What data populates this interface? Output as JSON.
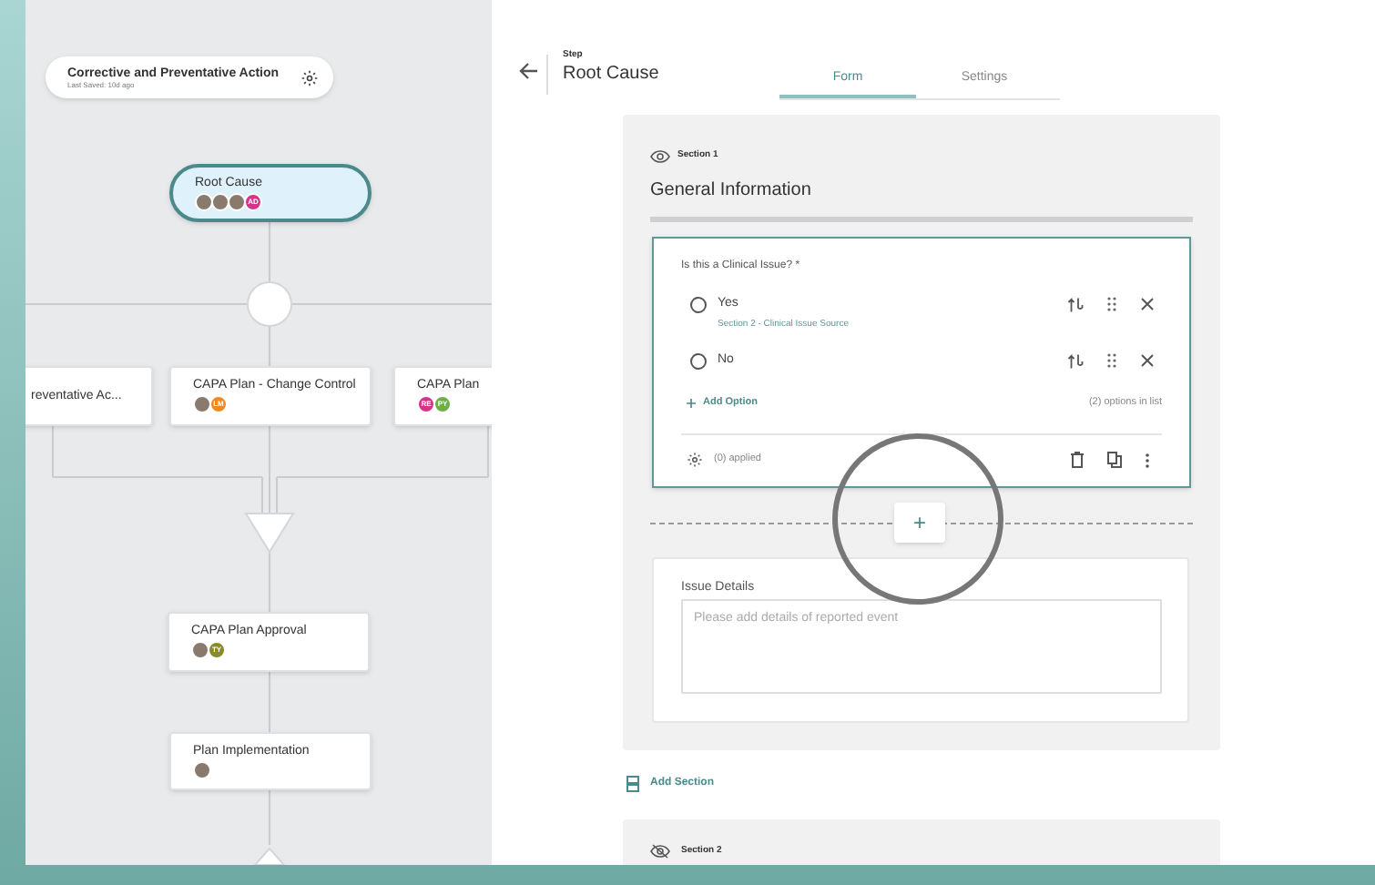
{
  "workflow": {
    "title": "Corrective and Preventative Action",
    "subtitle": "Last Saved: 10d ago"
  },
  "flow_nodes": [
    {
      "label": "Root Cause",
      "selected": true,
      "avatars": [
        {
          "kind": "photo"
        },
        {
          "kind": "photo"
        },
        {
          "kind": "photo"
        },
        {
          "kind": "initials",
          "text": "AD",
          "color": "#d6338a"
        }
      ]
    },
    {
      "label": "reventative Ac...",
      "selected": false
    },
    {
      "label": "CAPA Plan - Change Control",
      "selected": false,
      "avatars": [
        {
          "kind": "photo"
        },
        {
          "kind": "initials",
          "text": "LM",
          "color": "#f08a1c"
        }
      ]
    },
    {
      "label": "CAPA Plan",
      "selected": false,
      "avatars": [
        {
          "kind": "initials",
          "text": "RE",
          "color": "#d6338a"
        },
        {
          "kind": "initials",
          "text": "PY",
          "color": "#6db04a"
        }
      ]
    },
    {
      "label": "CAPA Plan Approval",
      "selected": false,
      "avatars": [
        {
          "kind": "photo"
        },
        {
          "kind": "initials",
          "text": "TY",
          "color": "#8a8a2a"
        }
      ]
    },
    {
      "label": "Plan Implementation",
      "selected": false,
      "avatars": [
        {
          "kind": "photo"
        }
      ]
    }
  ],
  "step": {
    "caption": "Step",
    "title": "Root Cause"
  },
  "tabs": [
    {
      "label": "Form",
      "selected": true
    },
    {
      "label": "Settings",
      "selected": false
    }
  ],
  "sections": [
    {
      "label": "Section 1",
      "visible": true,
      "title": "General Information",
      "question": {
        "label": "Is this a Clinical Issue? *",
        "options": [
          {
            "label": "Yes",
            "selected": false,
            "link": "Section 2 - Clinical Issue Source"
          },
          {
            "label": "No",
            "selected": false
          }
        ],
        "add_option": "Add Option",
        "count": "(2) options in list",
        "rules": "(0) applied"
      },
      "add_button": "+",
      "field": {
        "label": "Issue Details",
        "placeholder": "Please add details of reported event"
      }
    },
    {
      "label": "Section 2",
      "visible": false
    }
  ],
  "add_section": "Add Section"
}
